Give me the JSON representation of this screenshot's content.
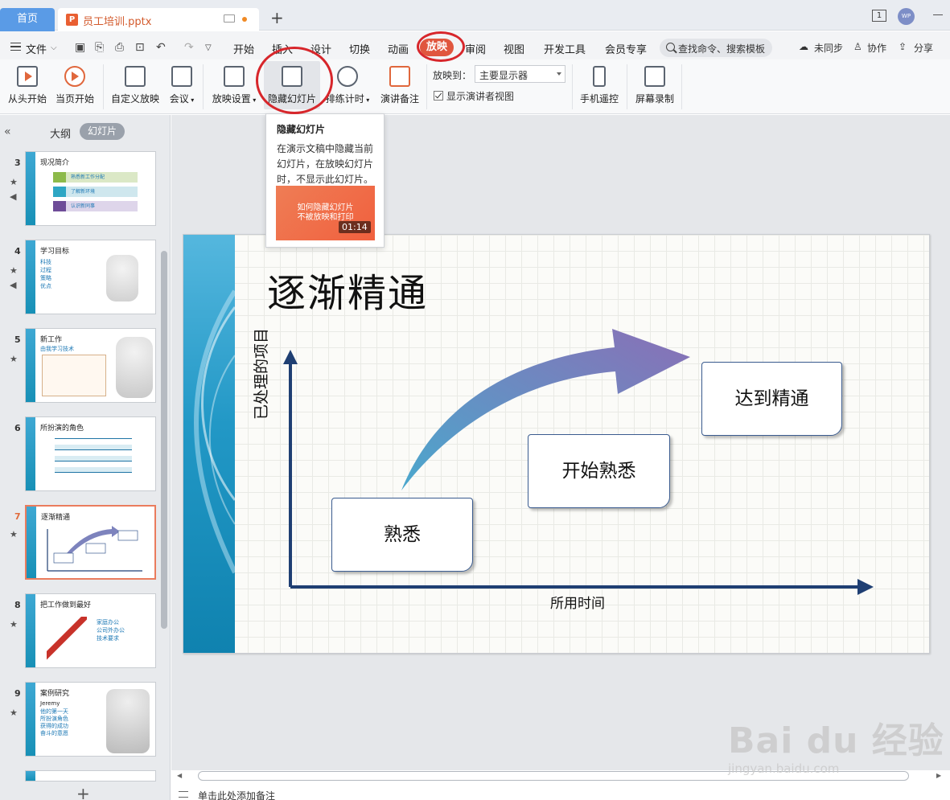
{
  "titlebar": {
    "home_tab": "首页",
    "doc_tab": "员工培训.pptx",
    "ppt_glyph": "P",
    "add_tab": "+",
    "window_num": "1",
    "avatar_text": "WP"
  },
  "menubar": {
    "file": "文件",
    "tabs": [
      "开始",
      "插入",
      "设计",
      "切换",
      "动画",
      "放映",
      "审阅",
      "视图",
      "开发工具",
      "会员专享"
    ],
    "search_placeholder": "查找命令、搜索模板",
    "sync": "未同步",
    "collab": "协作",
    "share": "分享"
  },
  "ribbon": {
    "from_start": "从头开始",
    "from_current": "当页开始",
    "custom_show": "自定义放映",
    "meeting": "会议",
    "show_settings": "放映设置",
    "hide_slide": "隐藏幻灯片",
    "rehearse": "排练计时",
    "speaker_notes": "演讲备注",
    "play_to_label": "放映到：",
    "play_to_value": "主要显示器",
    "presenter_view": "显示演讲者视图",
    "phone_remote": "手机遥控",
    "screen_record": "屏幕录制"
  },
  "tooltip": {
    "title": "隐藏幻灯片",
    "body": "在演示文稿中隐藏当前幻灯片，在放映幻灯片时，不显示此幻灯片。",
    "video_text": "如何隐藏幻灯片\n不被放映和打印",
    "duration": "01:14"
  },
  "leftpane": {
    "collapse": "«",
    "tab_outline": "大纲",
    "tab_slides": "幻灯片",
    "add": "+",
    "slides": [
      {
        "num": "3",
        "title": "现况简介",
        "items": [
          "熟悉新工作分配",
          "了解新环境",
          "认识新同事"
        ]
      },
      {
        "num": "4",
        "title": "学习目标",
        "items": [
          "科技",
          "过程",
          "策略",
          "优点"
        ]
      },
      {
        "num": "5",
        "title": "新工作",
        "subtitle": "由我学习技术"
      },
      {
        "num": "6",
        "title": "所扮演的角色"
      },
      {
        "num": "7",
        "title": "逐渐精通"
      },
      {
        "num": "8",
        "title": "把工作做到最好",
        "items": [
          "家庭办公",
          "公司外办公",
          "技术要求"
        ]
      },
      {
        "num": "9",
        "title": "案例研究",
        "items": [
          "Jeremy",
          "他的第一天",
          "所扮演角色",
          "获得的成功",
          "奋斗的意愿"
        ]
      }
    ]
  },
  "slide": {
    "title": "逐渐精通",
    "xlabel": "所用时间",
    "ylabel": "已处理的项目",
    "box1": "熟悉",
    "box2": "开始熟悉",
    "box3": "达到精通"
  },
  "notes": {
    "placeholder": "单击此处添加备注"
  },
  "watermark": {
    "main": "Bai du 经验",
    "sub": "jingyan.baidu.com"
  },
  "colors": {
    "accent": "#e0563e",
    "home_tab": "#5a9be6",
    "slide_bar": "#2298c6",
    "arrow": "#1f3f73"
  }
}
